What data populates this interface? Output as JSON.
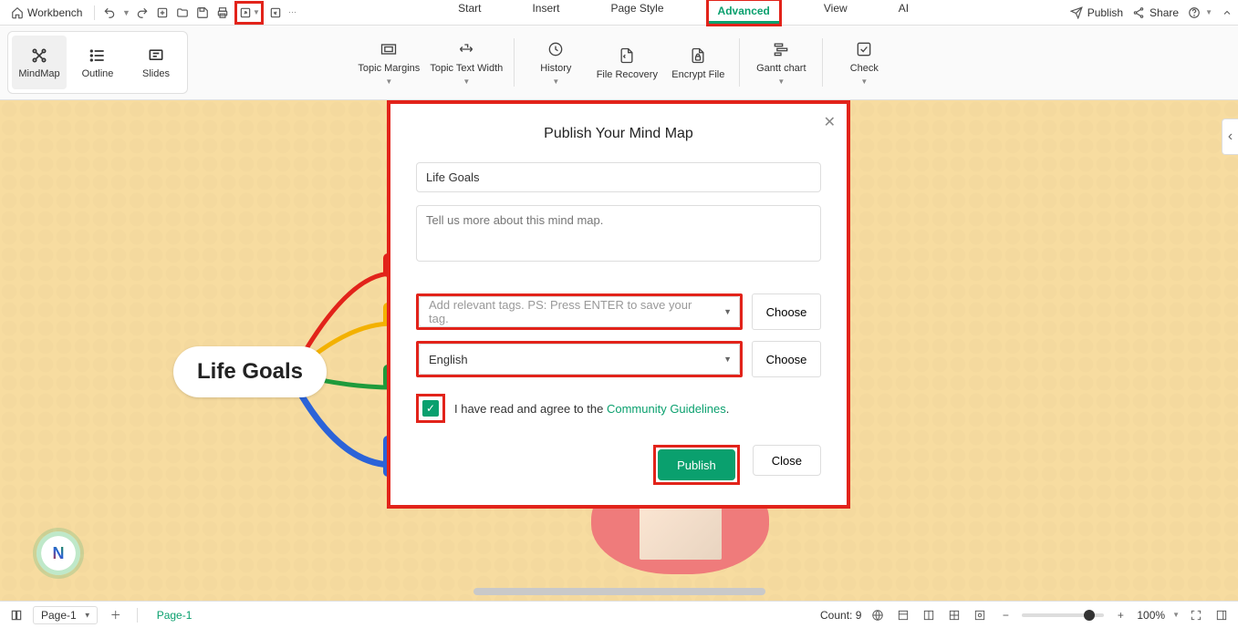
{
  "topbar": {
    "workbench": "Workbench",
    "menus": [
      "Start",
      "Insert",
      "Page Style",
      "Advanced",
      "View",
      "AI"
    ],
    "active_menu": "Advanced",
    "publish": "Publish",
    "share": "Share"
  },
  "view_modes": {
    "mindmap": "MindMap",
    "outline": "Outline",
    "slides": "Slides"
  },
  "tools": {
    "topic_margins": "Topic Margins",
    "topic_text_width": "Topic Text Width",
    "history": "History",
    "file_recovery": "File Recovery",
    "encrypt_file": "Encrypt File",
    "gantt_chart": "Gantt chart",
    "check": "Check"
  },
  "mindmap": {
    "root": "Life Goals"
  },
  "modal": {
    "title": "Publish Your Mind Map",
    "name_value": "Life Goals",
    "desc_placeholder": "Tell us more about this mind map.",
    "tags_placeholder": "Add relevant tags. PS: Press ENTER to save your tag.",
    "language_value": "English",
    "choose": "Choose",
    "agree_pre": "I have read and agree to the ",
    "agree_link": "Community Guidelines",
    "agree_post": ".",
    "publish": "Publish",
    "close": "Close",
    "checked": true
  },
  "statusbar": {
    "page_select": "Page-1",
    "page_tab": "Page-1",
    "count_label": "Count: 9",
    "zoom": "100%"
  }
}
